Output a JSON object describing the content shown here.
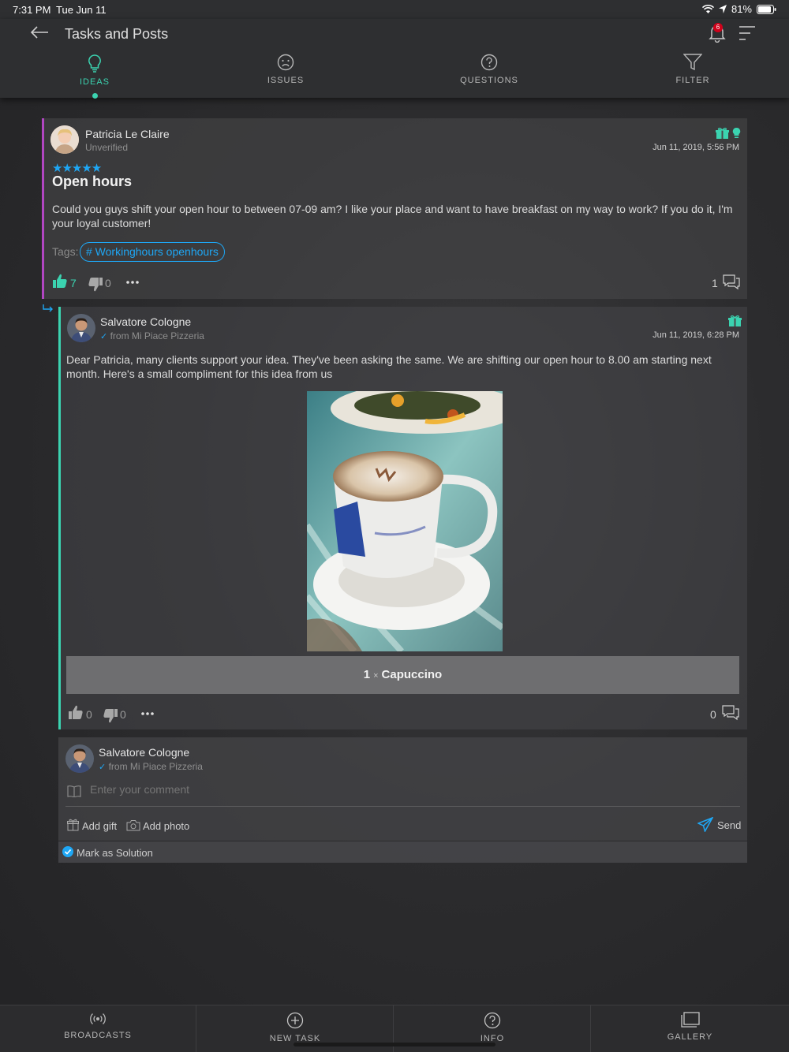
{
  "status_bar": {
    "time": "7:31 PM",
    "date": "Tue Jun 11",
    "battery": "81%"
  },
  "header": {
    "title": "Tasks and Posts",
    "notification_count": "6",
    "icons": [
      "back-arrow-icon",
      "bell-icon",
      "menu-icon"
    ]
  },
  "tabs": [
    {
      "label": "IDEAS",
      "icon": "lightbulb-icon",
      "active": true
    },
    {
      "label": "ISSUES",
      "icon": "sad-face-icon",
      "active": false
    },
    {
      "label": "QUESTIONS",
      "icon": "question-icon",
      "active": false
    },
    {
      "label": "FILTER",
      "icon": "filter-icon",
      "active": false
    }
  ],
  "post": {
    "author": "Patricia Le Claire",
    "author_status": "Unverified",
    "timestamp": "Jun 11, 2019, 5:56 PM",
    "stars": "★★★★★",
    "title": "Open hours",
    "body": "Could you guys shift your open hour to between 07-09 am? I like your place and want to have breakfast on my way to work? If you do it, I'm your loyal customer!",
    "tags_label": "Tags:",
    "tag": "# Workinghours openhours",
    "likes": "7",
    "dislikes": "0",
    "comments": "1"
  },
  "reply": {
    "author": "Salvatore Cologne",
    "affiliation": "from Mi Piace Pizzeria",
    "timestamp": "Jun 11, 2019, 6:28 PM",
    "body": "Dear Patricia, many clients support your idea. They've been asking the same. We are shifting our open hour to 8.00 am starting next month. Here's a small compliment for this idea from us",
    "gift_quantity": "1",
    "gift_times": "×",
    "gift_item": "Capuccino",
    "likes": "0",
    "dislikes": "0",
    "comments": "0"
  },
  "composer": {
    "author": "Salvatore Cologne",
    "affiliation": "from Mi Piace Pizzeria",
    "placeholder": "Enter your comment",
    "add_gift": "Add gift",
    "add_photo": "Add photo",
    "send": "Send",
    "mark_solution": "Mark as Solution"
  },
  "bottom_nav": [
    {
      "label": "BROADCASTS",
      "icon": "broadcast-icon"
    },
    {
      "label": "NEW TASK",
      "icon": "plus-circle-icon"
    },
    {
      "label": "INFO",
      "icon": "info-icon"
    },
    {
      "label": "GALLERY",
      "icon": "gallery-icon"
    }
  ],
  "colors": {
    "accent_green": "#3bd3b0",
    "accent_blue": "#1ea7f5",
    "idea_purple": "#b146c2",
    "badge_red": "#d0021b"
  }
}
